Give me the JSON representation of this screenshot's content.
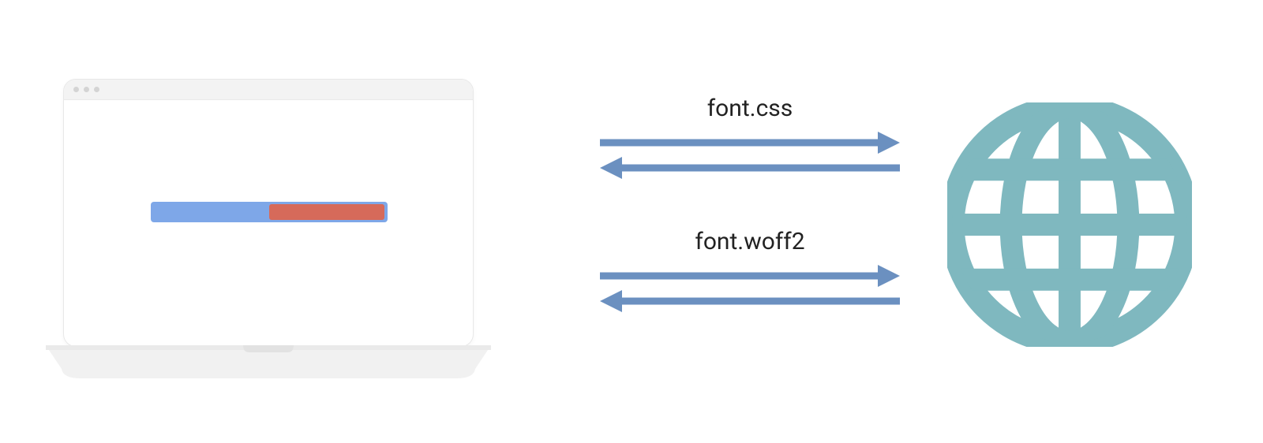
{
  "requests": {
    "first": {
      "label": "font.css"
    },
    "second": {
      "label": "font.woff2"
    }
  },
  "progress": {
    "total_percent": 100,
    "remaining_percent": 50
  },
  "colors": {
    "arrow": "#6b90c0",
    "progress_blue": "#7ea7e8",
    "progress_red": "#d66a5a",
    "globe": "#7fb8bf"
  }
}
